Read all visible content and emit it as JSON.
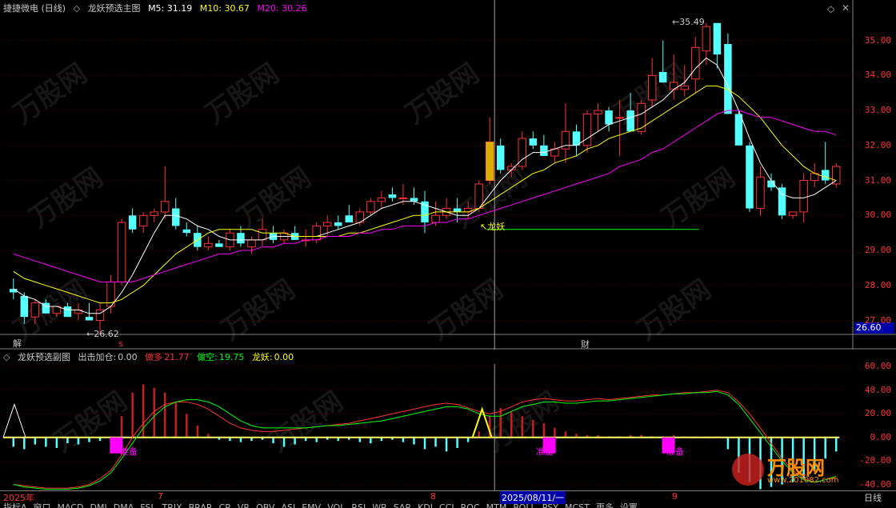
{
  "main_header": {
    "stock_name": "捷捷微电 (日线)",
    "indicator_name": "龙妖预选主图",
    "ma5": "M5: 31.19",
    "ma10": "M10: 30.67",
    "ma20": "M20: 30.26"
  },
  "main_labels": {
    "high_price": "35.49",
    "low_price": "26.62",
    "annotation": "龙妖",
    "event_jie": "解",
    "event_s": "s",
    "event_cai": "财",
    "current_price": "26.60"
  },
  "price_axis": [
    "35.00",
    "34.00",
    "33.00",
    "32.00",
    "31.00",
    "30.00",
    "29.00",
    "28.00",
    "27.00"
  ],
  "sub_header": {
    "name": "龙妖预选副图",
    "buy_label": "出击加仓:",
    "buy_value": "0.00",
    "long_label": "做多",
    "long_value": "21.77",
    "short_label": "做空:",
    "short_value": "19.75",
    "dragon_label": "龙妖:",
    "dragon_value": "0.00"
  },
  "sub_axis": [
    "60.00",
    "40.00",
    "20.00",
    "0.00",
    "-20.00",
    "-40.00"
  ],
  "ready_labels": [
    "准备",
    "准备",
    "准备"
  ],
  "time_axis": {
    "year": "2025年",
    "m7": "7",
    "m8": "8",
    "cursor_date": "2025/08/11/一",
    "m9": "9",
    "period": "日线"
  },
  "bottom_tabs": [
    "指标A",
    "窗口",
    "MACD",
    "DMI",
    "DMA",
    "FSL",
    "TRIX",
    "BRAR",
    "CR",
    "VR",
    "OBV",
    "ASI",
    "EMV",
    "VOL",
    "RSI",
    "WR",
    "SAR",
    "KDJ",
    "CCI",
    "ROC",
    "MTM",
    "BOLL",
    "PSY",
    "MCST",
    "更多",
    "设置"
  ],
  "watermark": "万股网",
  "watermark_url": "www.201082.com",
  "colors": {
    "bull": "#ff3232",
    "bear": "#54ffff",
    "ma5": "#ffffff",
    "ma10": "#ffff00",
    "ma20": "#ff00ff",
    "long_line": "#ff3232",
    "short_line": "#00ff00",
    "ready": "#ff00ff"
  },
  "chart_data": [
    {
      "type": "candlestick",
      "title": "龙妖预选主图",
      "ylim": [
        26.6,
        35.7
      ],
      "ohlc": [
        [
          27.9,
          28.2,
          27.6,
          27.8
        ],
        [
          27.7,
          27.8,
          26.9,
          27.1
        ],
        [
          27.1,
          27.6,
          26.9,
          27.5
        ],
        [
          27.5,
          27.6,
          27.2,
          27.2
        ],
        [
          27.2,
          27.4,
          27.1,
          27.4
        ],
        [
          27.4,
          27.5,
          27.1,
          27.1
        ],
        [
          27.2,
          27.5,
          27.0,
          27.3
        ],
        [
          27.1,
          27.5,
          27.0,
          27.0
        ],
        [
          27.0,
          27.5,
          26.6,
          27.3
        ],
        [
          27.4,
          28.3,
          27.2,
          28.1
        ],
        [
          28.1,
          29.9,
          28.0,
          29.8
        ],
        [
          30.0,
          30.2,
          29.5,
          29.6
        ],
        [
          29.7,
          30.1,
          29.5,
          30.0
        ],
        [
          30.0,
          30.2,
          29.8,
          30.1
        ],
        [
          30.1,
          31.4,
          29.9,
          30.4
        ],
        [
          30.2,
          30.5,
          29.6,
          29.7
        ],
        [
          29.6,
          29.8,
          29.4,
          29.5
        ],
        [
          29.5,
          29.7,
          29.0,
          29.1
        ],
        [
          29.1,
          29.4,
          29.0,
          29.2
        ],
        [
          29.2,
          29.3,
          29.1,
          29.1
        ],
        [
          29.1,
          29.6,
          29.0,
          29.5
        ],
        [
          29.5,
          29.7,
          29.1,
          29.2
        ],
        [
          29.1,
          29.4,
          28.9,
          29.3
        ],
        [
          29.3,
          29.9,
          29.1,
          29.6
        ],
        [
          29.5,
          29.7,
          29.2,
          29.3
        ],
        [
          29.3,
          29.6,
          29.2,
          29.5
        ],
        [
          29.5,
          29.7,
          29.3,
          29.3
        ],
        [
          29.3,
          29.6,
          29.1,
          29.3
        ],
        [
          29.3,
          29.8,
          29.2,
          29.7
        ],
        [
          29.7,
          30.0,
          29.4,
          29.8
        ],
        [
          29.8,
          30.0,
          29.6,
          29.7
        ],
        [
          30.0,
          30.3,
          29.8,
          29.8
        ],
        [
          29.8,
          30.2,
          29.7,
          30.1
        ],
        [
          30.1,
          30.5,
          30.0,
          30.4
        ],
        [
          30.4,
          30.7,
          30.2,
          30.5
        ],
        [
          30.6,
          30.8,
          30.4,
          30.5
        ],
        [
          30.5,
          30.9,
          30.3,
          30.5
        ],
        [
          30.5,
          30.8,
          30.3,
          30.4
        ],
        [
          30.4,
          30.7,
          29.5,
          29.8
        ],
        [
          29.8,
          30.4,
          29.7,
          30.0
        ],
        [
          30.0,
          30.5,
          29.9,
          30.2
        ],
        [
          30.2,
          30.5,
          29.8,
          30.1
        ],
        [
          30.1,
          30.4,
          29.9,
          30.2
        ],
        [
          30.2,
          31.0,
          30.1,
          30.9
        ],
        [
          31.0,
          32.8,
          30.9,
          32.1
        ],
        [
          32.0,
          32.2,
          31.2,
          31.3
        ],
        [
          31.3,
          31.5,
          31.1,
          31.4
        ],
        [
          31.4,
          32.4,
          31.3,
          32.2
        ],
        [
          32.2,
          32.4,
          31.9,
          32.0
        ],
        [
          32.0,
          32.3,
          31.7,
          31.7
        ],
        [
          31.7,
          32.1,
          31.5,
          31.9
        ],
        [
          31.9,
          33.2,
          31.5,
          32.4
        ],
        [
          32.4,
          32.6,
          31.7,
          32.0
        ],
        [
          32.0,
          33.0,
          31.8,
          32.9
        ],
        [
          32.9,
          33.2,
          32.4,
          33.0
        ],
        [
          33.0,
          33.1,
          32.4,
          32.6
        ],
        [
          32.8,
          33.3,
          31.7,
          32.8
        ],
        [
          33.0,
          33.5,
          32.4,
          32.4
        ],
        [
          32.4,
          33.3,
          32.3,
          33.2
        ],
        [
          33.3,
          34.5,
          33.1,
          34.0
        ],
        [
          34.1,
          35.0,
          33.8,
          33.8
        ],
        [
          33.6,
          34.6,
          33.3,
          33.8
        ],
        [
          33.6,
          34.3,
          33.4,
          33.7
        ],
        [
          33.9,
          35.1,
          33.5,
          34.8
        ],
        [
          34.7,
          35.5,
          34.3,
          35.4
        ],
        [
          35.5,
          35.49,
          34.2,
          34.6
        ],
        [
          34.9,
          35.2,
          33.0,
          32.9
        ],
        [
          32.9,
          33.0,
          32.0,
          32.0
        ],
        [
          32.0,
          32.1,
          30.1,
          30.2
        ],
        [
          30.2,
          31.4,
          30.0,
          31.1
        ],
        [
          31.0,
          31.2,
          30.7,
          30.8
        ],
        [
          30.8,
          30.9,
          29.9,
          30.0
        ],
        [
          30.0,
          30.1,
          29.9,
          30.1
        ],
        [
          30.1,
          31.2,
          29.8,
          31.0
        ],
        [
          31.0,
          31.5,
          30.8,
          31.2
        ],
        [
          31.3,
          32.1,
          30.9,
          31.0
        ],
        [
          30.9,
          31.5,
          30.8,
          31.4
        ]
      ],
      "series": [
        {
          "name": "M5",
          "values": [
            27.9,
            27.7,
            27.6,
            27.4,
            27.4,
            27.3,
            27.3,
            27.2,
            27.2,
            27.4,
            27.8,
            28.3,
            28.9,
            29.5,
            30.0,
            30.0,
            29.9,
            29.7,
            29.6,
            29.4,
            29.3,
            29.3,
            29.3,
            29.3,
            29.4,
            29.4,
            29.4,
            29.4,
            29.4,
            29.5,
            29.6,
            29.7,
            29.8,
            30.0,
            30.2,
            30.3,
            30.4,
            30.4,
            30.3,
            30.2,
            30.1,
            30.0,
            30.0,
            30.2,
            30.6,
            31.0,
            31.3,
            31.6,
            31.8,
            31.8,
            31.9,
            32.0,
            32.0,
            32.2,
            32.4,
            32.6,
            32.7,
            32.8,
            32.9,
            33.1,
            33.3,
            33.6,
            33.8,
            34.2,
            34.5,
            34.3,
            33.7,
            33.0,
            32.2,
            31.5,
            31.0,
            30.6,
            30.5,
            30.5,
            30.6,
            30.8,
            31.0
          ]
        },
        {
          "name": "M10",
          "values": [
            28.4,
            28.2,
            28.1,
            28.0,
            27.9,
            27.8,
            27.7,
            27.6,
            27.5,
            27.5,
            27.6,
            27.8,
            28.0,
            28.3,
            28.6,
            28.9,
            29.1,
            29.3,
            29.5,
            29.6,
            29.6,
            29.6,
            29.6,
            29.5,
            29.5,
            29.5,
            29.4,
            29.4,
            29.4,
            29.4,
            29.4,
            29.5,
            29.5,
            29.6,
            29.7,
            29.8,
            29.9,
            30.0,
            30.0,
            30.1,
            30.1,
            30.1,
            30.1,
            30.2,
            30.4,
            30.6,
            30.8,
            31.0,
            31.2,
            31.3,
            31.5,
            31.6,
            31.7,
            31.9,
            32.0,
            32.2,
            32.3,
            32.4,
            32.5,
            32.7,
            32.9,
            33.1,
            33.3,
            33.5,
            33.7,
            33.7,
            33.6,
            33.4,
            33.1,
            32.8,
            32.4,
            32.0,
            31.7,
            31.4,
            31.2,
            31.1,
            31.0
          ]
        },
        {
          "name": "M20",
          "values": [
            28.9,
            28.8,
            28.7,
            28.6,
            28.5,
            28.4,
            28.3,
            28.2,
            28.1,
            28.1,
            28.1,
            28.1,
            28.2,
            28.3,
            28.4,
            28.5,
            28.6,
            28.7,
            28.8,
            28.9,
            28.9,
            29.0,
            29.0,
            29.1,
            29.1,
            29.2,
            29.2,
            29.3,
            29.3,
            29.4,
            29.4,
            29.4,
            29.5,
            29.5,
            29.6,
            29.6,
            29.7,
            29.7,
            29.7,
            29.8,
            29.8,
            29.9,
            29.9,
            30.0,
            30.1,
            30.2,
            30.3,
            30.4,
            30.5,
            30.6,
            30.7,
            30.8,
            30.9,
            31.0,
            31.1,
            31.2,
            31.4,
            31.5,
            31.6,
            31.8,
            31.9,
            32.1,
            32.3,
            32.5,
            32.7,
            32.9,
            33.0,
            33.0,
            32.9,
            32.8,
            32.8,
            32.7,
            32.6,
            32.5,
            32.4,
            32.4,
            32.3
          ]
        }
      ]
    },
    {
      "type": "bar",
      "title": "龙妖预选副图",
      "ylim": [
        -45,
        65
      ],
      "bars": [
        -8,
        -10,
        -6,
        -8,
        -9,
        -5,
        -6,
        -4,
        -3,
        -2,
        18,
        38,
        45,
        42,
        38,
        30,
        20,
        10,
        3,
        -2,
        -3,
        -4,
        -3,
        -2,
        -5,
        -8,
        -6,
        -3,
        -4,
        -2,
        -3,
        -2,
        -4,
        -5,
        -3,
        -2,
        -4,
        -6,
        -10,
        -8,
        -12,
        -9,
        -4,
        5,
        18,
        25,
        22,
        18,
        15,
        12,
        8,
        5,
        3,
        2,
        2,
        1,
        1,
        2,
        2,
        1,
        1,
        2,
        1,
        1,
        1,
        1,
        -10,
        -30,
        -38,
        -44,
        -42,
        -40,
        -38,
        -35,
        -28,
        -18,
        -12
      ],
      "series": [
        {
          "name": "做多",
          "values": [
            -40,
            -41,
            -42,
            -43,
            -43,
            -43,
            -42,
            -40,
            -35,
            -28,
            -15,
            0,
            12,
            22,
            28,
            30,
            30,
            28,
            24,
            18,
            12,
            8,
            6,
            5,
            5,
            6,
            7,
            8,
            9,
            10,
            11,
            12,
            14,
            16,
            18,
            20,
            22,
            24,
            26,
            28,
            29,
            28,
            25,
            22,
            20,
            22,
            26,
            30,
            32,
            33,
            32,
            31,
            31,
            32,
            33,
            32,
            33,
            34,
            35,
            36,
            36,
            37,
            38,
            38,
            39,
            40,
            38,
            30,
            20,
            8,
            -5,
            -18,
            -28,
            -35,
            -38,
            -36,
            -34
          ]
        },
        {
          "name": "做空",
          "values": [
            -40,
            -42,
            -43,
            -44,
            -44,
            -44,
            -43,
            -41,
            -37,
            -30,
            -18,
            -5,
            8,
            18,
            26,
            30,
            32,
            32,
            30,
            26,
            20,
            14,
            10,
            8,
            8,
            8,
            8,
            8,
            9,
            10,
            10,
            11,
            12,
            13,
            14,
            16,
            18,
            20,
            22,
            24,
            26,
            26,
            24,
            20,
            18,
            18,
            22,
            26,
            28,
            30,
            30,
            29,
            29,
            30,
            31,
            31,
            32,
            33,
            34,
            35,
            36,
            37,
            37,
            38,
            38,
            39,
            36,
            28,
            16,
            4,
            -8,
            -20,
            -30,
            -36,
            -38,
            -36,
            -33
          ]
        }
      ]
    }
  ]
}
